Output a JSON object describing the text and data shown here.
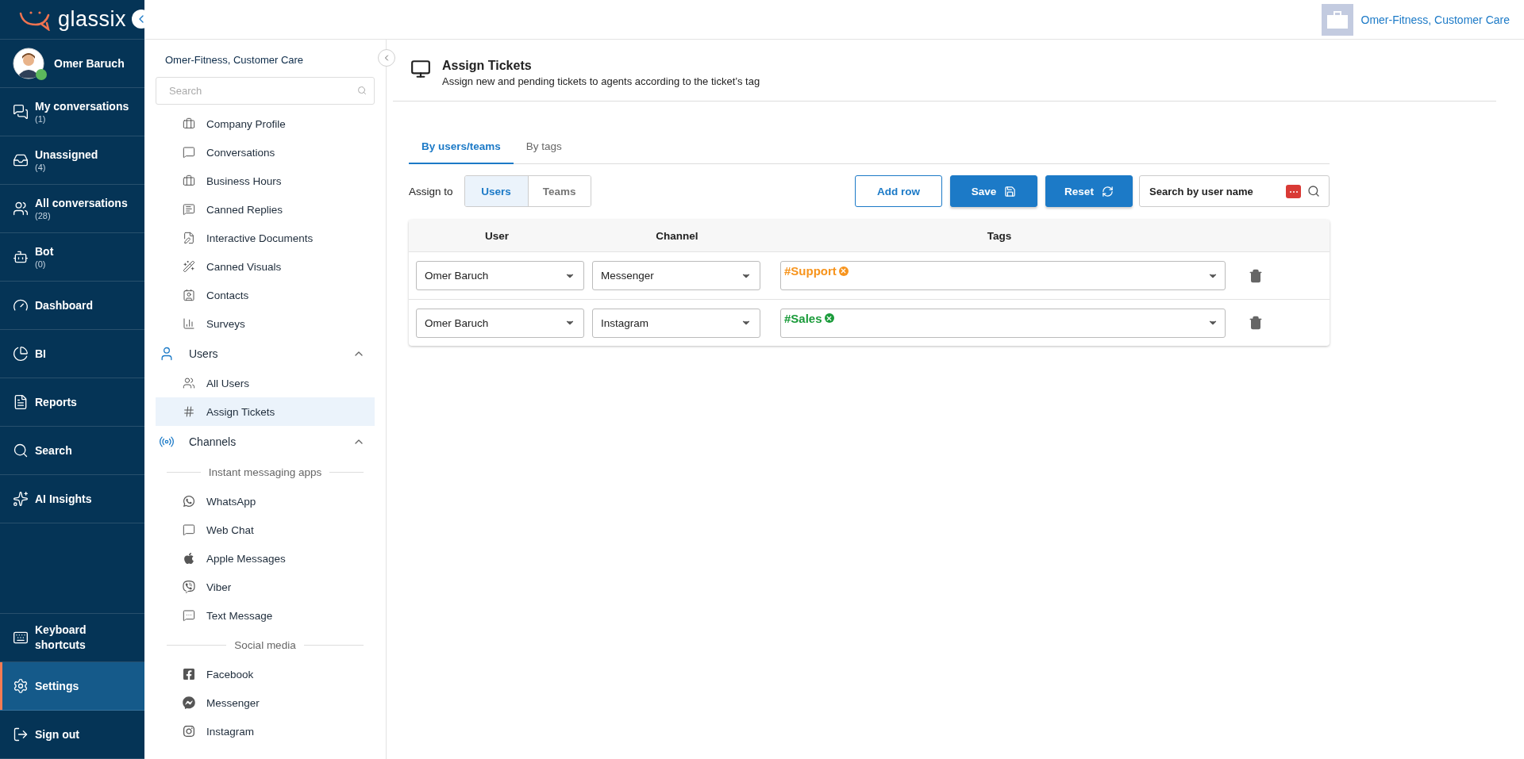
{
  "logo": {
    "text": "glassix"
  },
  "nav": {
    "user": {
      "name": "Omer Baruch",
      "online": true
    },
    "items": [
      {
        "label": "My conversations",
        "count": "(1)",
        "selected": false
      },
      {
        "label": "Unassigned",
        "count": "(4)",
        "selected": false
      },
      {
        "label": "All conversations",
        "count": "(28)",
        "selected": false
      },
      {
        "label": "Bot",
        "count": "(0)",
        "selected": false
      },
      {
        "label": "Dashboard",
        "selected": false
      },
      {
        "label": "BI",
        "selected": false
      },
      {
        "label": "Reports",
        "selected": false
      },
      {
        "label": "Search",
        "selected": false
      },
      {
        "label": "AI Insights",
        "selected": false
      }
    ],
    "bottom_items": [
      {
        "label": "Keyboard shortcuts",
        "selected": false
      },
      {
        "label": "Settings",
        "selected": true
      },
      {
        "label": "Sign out",
        "selected": false
      }
    ]
  },
  "topbar": {
    "account": "Omer-Fitness, Customer Care"
  },
  "settings_sidebar": {
    "title": "Omer-Fitness, Customer Care",
    "search": {
      "placeholder": "Search"
    },
    "items": [
      {
        "kind": "item",
        "label": "Company Profile",
        "selected": false
      },
      {
        "kind": "item",
        "label": "Conversations",
        "selected": false
      },
      {
        "kind": "item",
        "label": "Business Hours",
        "selected": false
      },
      {
        "kind": "item",
        "label": "Canned Replies",
        "selected": false
      },
      {
        "kind": "item",
        "label": "Interactive Documents",
        "selected": false
      },
      {
        "kind": "item",
        "label": "Canned Visuals",
        "selected": false
      },
      {
        "kind": "item",
        "label": "Contacts",
        "selected": false
      },
      {
        "kind": "item",
        "label": "Surveys",
        "selected": false
      },
      {
        "kind": "group",
        "label": "Users",
        "expanded": true,
        "children": [
          {
            "kind": "item",
            "label": "All Users",
            "selected": false
          },
          {
            "kind": "item",
            "label": "Assign Tickets",
            "selected": true
          }
        ]
      },
      {
        "kind": "group",
        "label": "Channels",
        "expanded": true,
        "children": [
          {
            "kind": "subheader",
            "label": "Instant messaging apps"
          },
          {
            "kind": "item",
            "label": "WhatsApp",
            "selected": false
          },
          {
            "kind": "item",
            "label": "Web Chat",
            "selected": false
          },
          {
            "kind": "item",
            "label": "Apple Messages",
            "selected": false
          },
          {
            "kind": "item",
            "label": "Viber",
            "selected": false
          },
          {
            "kind": "item",
            "label": "Text Message",
            "selected": false
          },
          {
            "kind": "subheader",
            "label": "Social media"
          },
          {
            "kind": "item",
            "label": "Facebook",
            "selected": false
          },
          {
            "kind": "item",
            "label": "Messenger",
            "selected": false
          },
          {
            "kind": "item",
            "label": "Instagram",
            "selected": false
          }
        ]
      }
    ]
  },
  "page": {
    "title": "Assign Tickets",
    "subtitle": "Assign new and pending tickets to agents according to the ticket’s tag",
    "tabs": [
      {
        "label": "By users/teams",
        "selected": true
      },
      {
        "label": "By tags",
        "selected": false
      }
    ],
    "assign_to": {
      "label": "Assign to",
      "options": [
        {
          "label": "Users",
          "selected": true
        },
        {
          "label": "Teams",
          "selected": false
        }
      ]
    },
    "buttons": {
      "add_row": "Add row",
      "save": "Save",
      "reset": "Reset"
    },
    "search": {
      "placeholder": "Search by user name"
    },
    "table": {
      "columns": [
        "User",
        "Channel",
        "Tags"
      ],
      "rows": [
        {
          "user": "Omer Baruch",
          "channel": "Messenger",
          "tags": [
            {
              "label": "#Support",
              "color": "#f7941d"
            }
          ]
        },
        {
          "user": "Omer Baruch",
          "channel": "Instagram",
          "tags": [
            {
              "label": "#Sales",
              "color": "#1a9b3a"
            }
          ]
        }
      ]
    }
  }
}
